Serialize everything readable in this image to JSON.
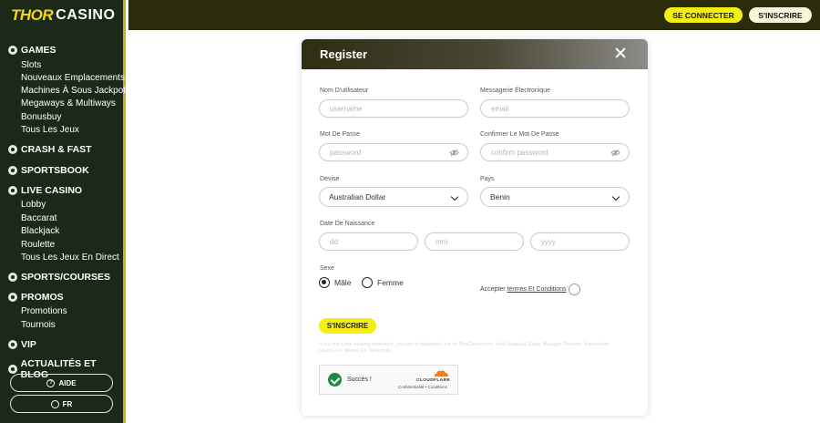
{
  "brand": {
    "logo_main": "THOR",
    "logo_suffix": "CASINO"
  },
  "sidebar": {
    "sections": [
      {
        "label": "GAMES",
        "icon": "dice-icon"
      },
      {
        "label": "CRASH & FAST",
        "icon": "rocket-icon"
      },
      {
        "label": "SPORTSBOOK",
        "icon": "ball-icon"
      },
      {
        "label": "LIVE CASINO",
        "icon": "chip-icon"
      },
      {
        "label": "SPORTS/COURSES",
        "icon": "trophy-icon"
      },
      {
        "label": "PROMOS",
        "icon": "gift-icon"
      },
      {
        "label": "VIP",
        "icon": "crown-icon"
      },
      {
        "label": "ACTUALITÉS ET BLOG",
        "icon": "news-icon"
      }
    ],
    "games_items": [
      "Slots",
      "Nouveaux Emplacements",
      "Machines À Sous Jackpot",
      "Megaways & Multiways",
      "Bonusbuy",
      "Tous Les Jeux"
    ],
    "live_items": [
      "Lobby",
      "Baccarat",
      "Blackjack",
      "Roulette",
      "Tous Les Jeux En Direct"
    ],
    "promo_items": [
      "Promotions",
      "Tournois"
    ],
    "help_label": "AIDE",
    "lang_label": "FR"
  },
  "header": {
    "login_label": "SE CONNECTER",
    "signup_label": "S'INSCRIRE"
  },
  "modal": {
    "title": "Register",
    "username_label": "Nom D'utilisateur",
    "username_placeholder": "username",
    "email_label": "Messagerie Électronique",
    "email_placeholder": "email",
    "password_label": "Mot De Passe",
    "password_placeholder": "password",
    "confirm_label": "Confirmer Le Mot De Passe",
    "confirm_placeholder": "confirm password",
    "currency_label": "Devise",
    "currency_value": "Australian Dollar",
    "country_label": "Pays",
    "country_value": "Benin",
    "dob_label": "Date De Naissance",
    "dob_dd": "dd",
    "dob_mm": "mm",
    "dob_yyyy": "yyyy",
    "sex_label": "Sexe",
    "male_label": "Mâle",
    "female_label": "Femme",
    "terms_prefix": "Accepter",
    "terms_link": "termes Et Conditions",
    "submit_label": "S'INSCRIRE",
    "disclaimer": "If you find a site violating trademark, you can do trademark use on ThorCasino.com. Arial, Australia, Dollar, Manager, Resistor, Nonexistent, Casino, Ex, Mental, Ex, Nonempty",
    "captcha_text": "Succès !",
    "cf_brand": "CLOUDFLARE",
    "cf_links": "Confidentialité • Conditions"
  },
  "colors": {
    "accent": "#f5ef10",
    "sidebar_bg": "#1b2a18",
    "header_bg": "#2b2c0c",
    "success": "#1f8a3b",
    "cloudflare": "#f38020"
  }
}
